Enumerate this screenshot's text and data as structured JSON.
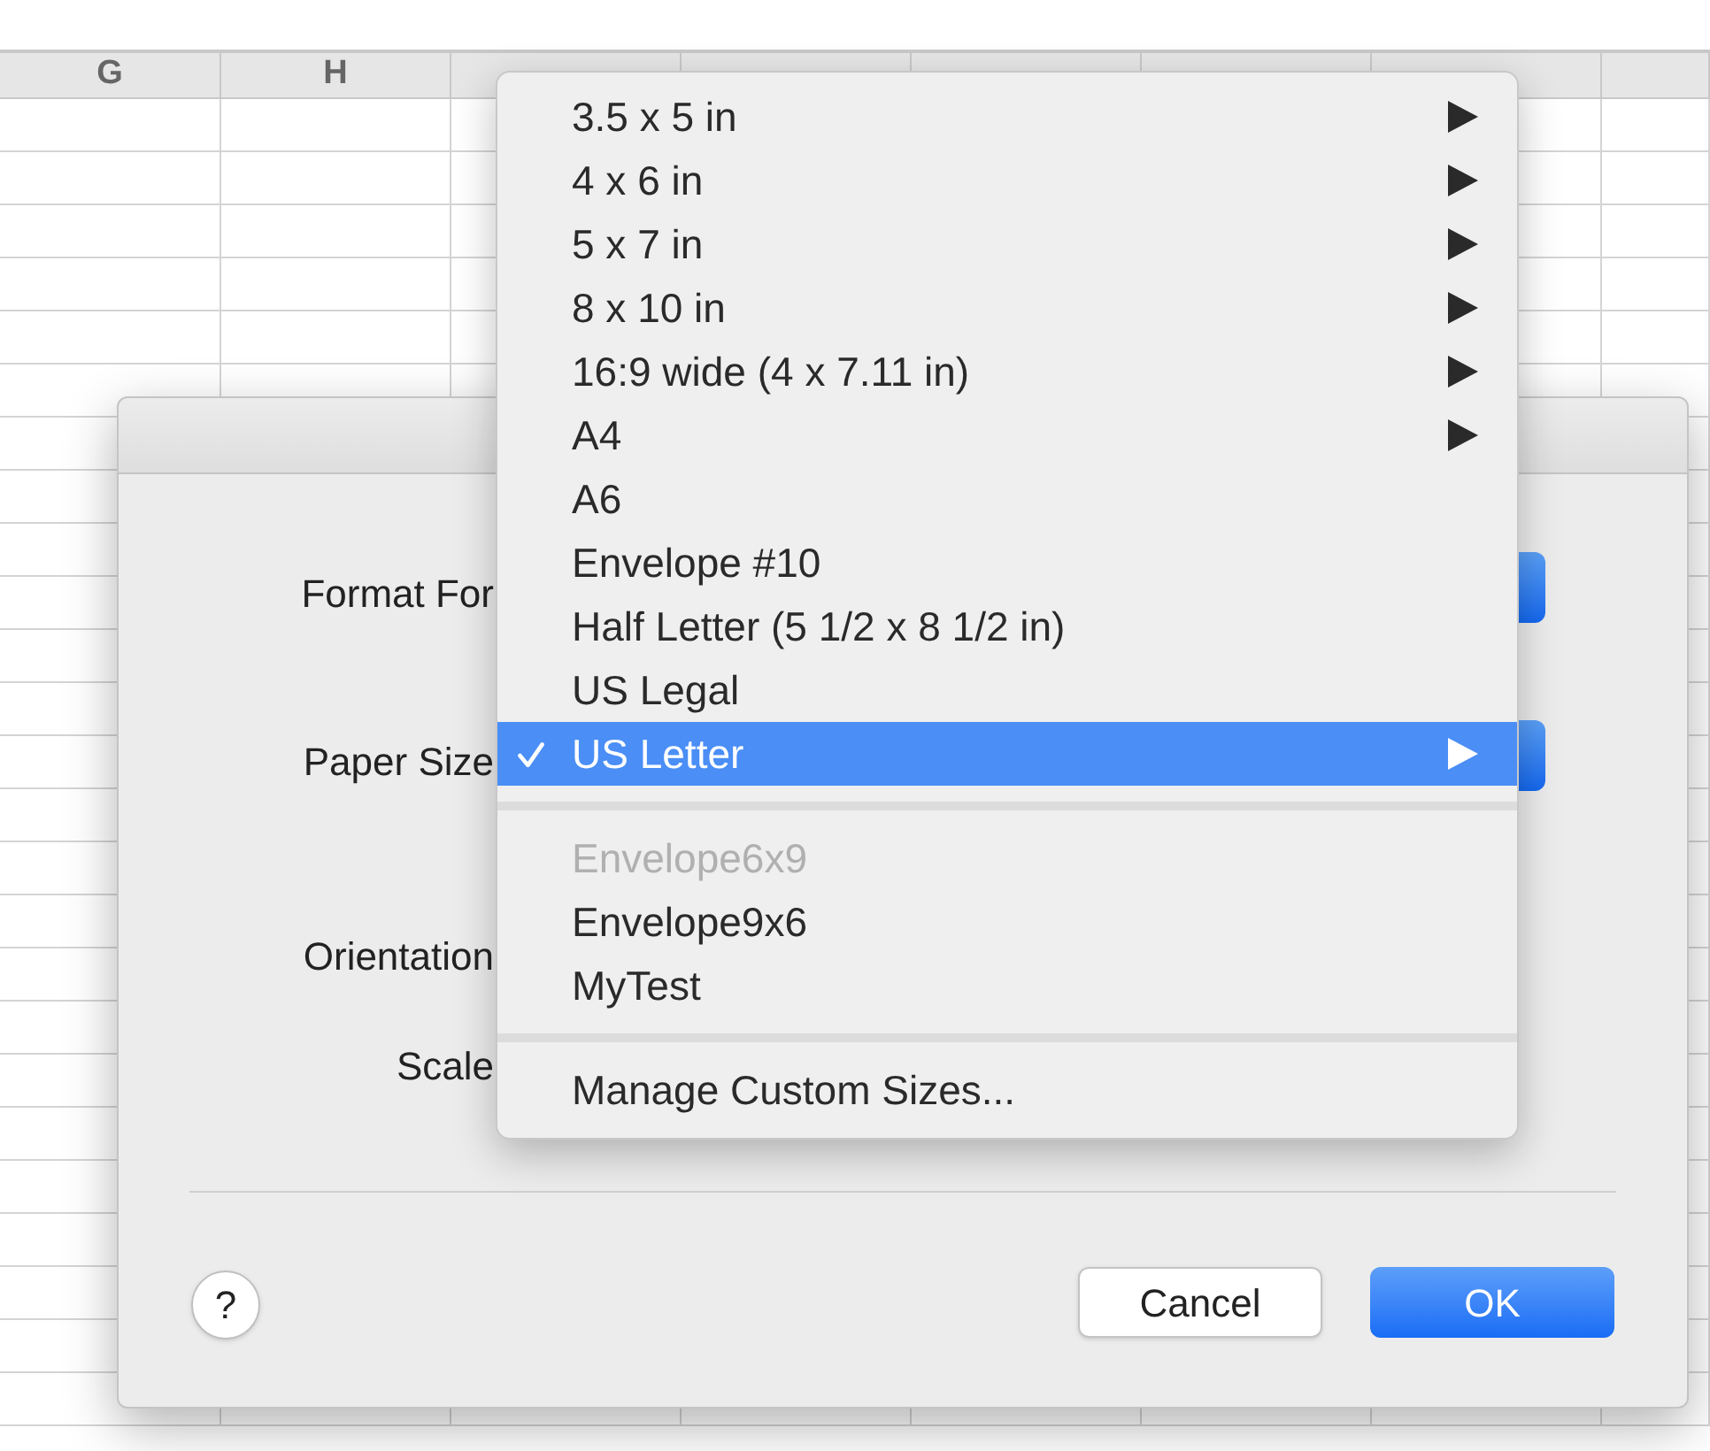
{
  "spreadsheet": {
    "columns": [
      "G",
      "H"
    ]
  },
  "dialog": {
    "fields": [
      {
        "label": "Format For",
        "kind": "popup"
      },
      {
        "label": "Paper Size",
        "kind": "popup"
      },
      {
        "label": "Orientation",
        "kind": "plain"
      },
      {
        "label": "Scale",
        "kind": "plain"
      }
    ],
    "help_button": "?",
    "buttons": [
      {
        "label": "Cancel",
        "default": false
      },
      {
        "label": "OK",
        "default": true
      }
    ]
  },
  "menu": {
    "items": [
      {
        "kind": "item",
        "label": "3.5 x 5 in",
        "submenu": true,
        "checked": false,
        "selected": false,
        "disabled": false
      },
      {
        "kind": "item",
        "label": "4 x 6 in",
        "submenu": true,
        "checked": false,
        "selected": false,
        "disabled": false
      },
      {
        "kind": "item",
        "label": "5 x 7 in",
        "submenu": true,
        "checked": false,
        "selected": false,
        "disabled": false
      },
      {
        "kind": "item",
        "label": "8 x 10 in",
        "submenu": true,
        "checked": false,
        "selected": false,
        "disabled": false
      },
      {
        "kind": "item",
        "label": "16:9 wide (4 x 7.11 in)",
        "submenu": true,
        "checked": false,
        "selected": false,
        "disabled": false
      },
      {
        "kind": "item",
        "label": "A4",
        "submenu": true,
        "checked": false,
        "selected": false,
        "disabled": false
      },
      {
        "kind": "item",
        "label": "A6",
        "submenu": false,
        "checked": false,
        "selected": false,
        "disabled": false
      },
      {
        "kind": "item",
        "label": "Envelope #10",
        "submenu": false,
        "checked": false,
        "selected": false,
        "disabled": false
      },
      {
        "kind": "item",
        "label": "Half Letter (5 1/2 x 8 1/2 in)",
        "submenu": false,
        "checked": false,
        "selected": false,
        "disabled": false
      },
      {
        "kind": "item",
        "label": "US Legal",
        "submenu": false,
        "checked": false,
        "selected": false,
        "disabled": false
      },
      {
        "kind": "item",
        "label": "US Letter",
        "submenu": true,
        "checked": true,
        "selected": true,
        "disabled": false
      },
      {
        "kind": "separator"
      },
      {
        "kind": "item",
        "label": "Envelope6x9",
        "submenu": false,
        "checked": false,
        "selected": false,
        "disabled": true
      },
      {
        "kind": "item",
        "label": "Envelope9x6",
        "submenu": false,
        "checked": false,
        "selected": false,
        "disabled": false
      },
      {
        "kind": "item",
        "label": "MyTest",
        "submenu": false,
        "checked": false,
        "selected": false,
        "disabled": false
      },
      {
        "kind": "separator"
      },
      {
        "kind": "item",
        "label": "Manage Custom Sizes...",
        "submenu": false,
        "checked": false,
        "selected": false,
        "disabled": false
      }
    ]
  }
}
